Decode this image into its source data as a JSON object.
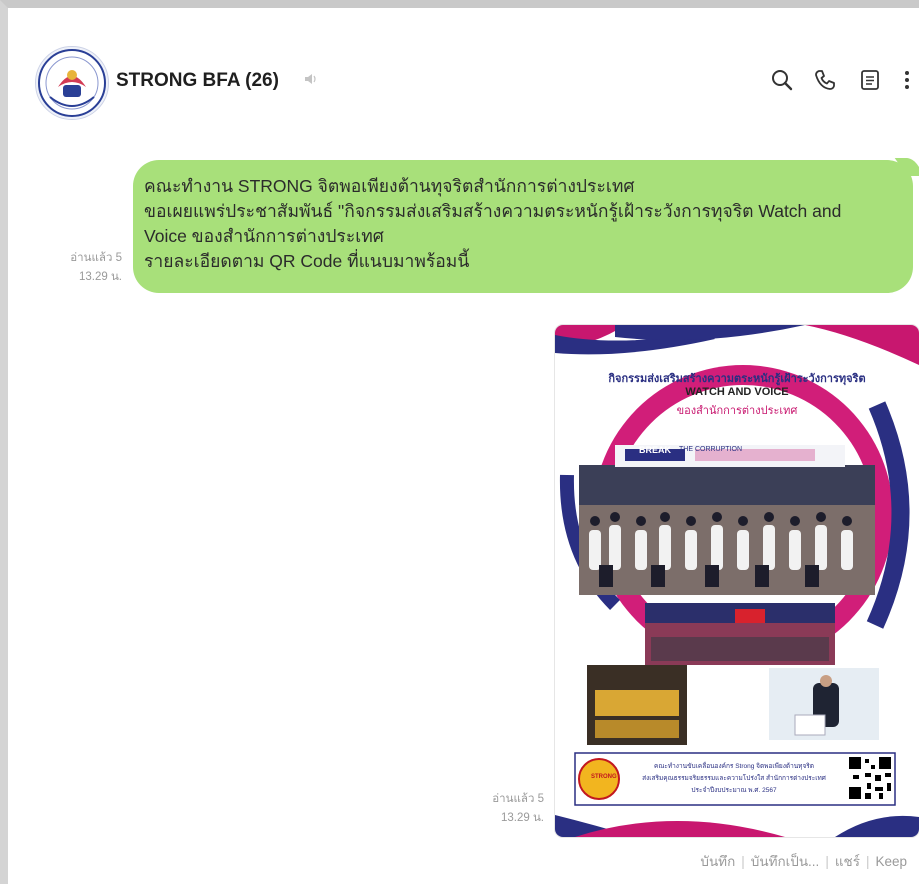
{
  "header": {
    "title": "STRONG BFA (26)"
  },
  "messages": [
    {
      "lines": [
        "คณะทำงาน STRONG จิตพอเพียงต้านทุจริตสำนักการต่างประเทศ",
        "ขอเผยแพร่ประชาสัมพันธ์ \"กิจกรรมส่งเสริมสร้างความตระหนักรู้เฝ้าระวังการทุจริต Watch and",
        "Voice ของสำนักการต่างประเทศ",
        "รายละเอียดตาม QR Code ที่แนบมาพร้อมนี้"
      ],
      "read_status": "อ่านแล้ว 5",
      "time": "13.29 น."
    },
    {
      "poster": {
        "title_line1": "กิจกรรมส่งเสริมสร้างความตระหนักรู้เฝ้าระวังการทุจริต",
        "title_line2": "WATCH AND VOICE",
        "title_line3": "ของสำนักการต่างประเทศ",
        "break_text": "BREAK",
        "break_sub": "THE CORRUPTION",
        "footer_line1": "คณะทำงานขับเคลื่อนองค์กร Strong จิตพอเพียงต้านทุจริต",
        "footer_line2": "ส่งเสริมคุณธรรมจริยธรรมและความโปร่งใส สำนักการต่างประเทศ",
        "footer_line3": "ประจำปีงบประมาณ พ.ศ. 2567",
        "badge_text": "STRONG"
      },
      "read_status": "อ่านแล้ว 5",
      "time": "13.29 น."
    }
  ],
  "actions": [
    "บันทึก",
    "บันทึกเป็น...",
    "แชร์",
    "Keep"
  ],
  "colors": {
    "bubble": "#a8e07a",
    "poster_magenta": "#c8176f",
    "poster_navy": "#2a2f82"
  }
}
